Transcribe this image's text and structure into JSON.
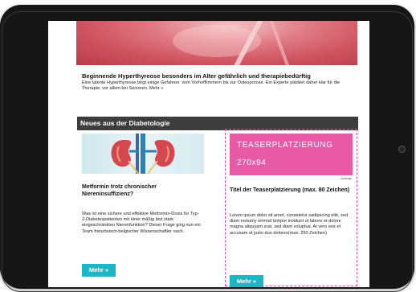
{
  "top_article": {
    "title": "Beginnende Hyperthyreose besonders im Alter gefährlich und therapiebedürftig",
    "text": "Eine latente Hyperthyreose birgt einige Gefahren: vom Vorhofflimmern bis zur Osteoporose. Ein Experte plädiert daher klar für die Therapie, vor allem bei Senioren. Mehr »"
  },
  "section": {
    "title": "Neues aus der Diabetologie"
  },
  "left_article": {
    "title": "Metformin trotz chronischer Niereninsuffizienz?",
    "text": "Was ist eine sichere und effektive Metformin-Dosis für Typ-2-Diabetespatienten mit einer mäßig bist stark eingeschränkten Nierenfunktion? Dieser Frage ging nun ein Team französisch-belgischer Wissenschaftler nach.",
    "button_label": "Mehr »"
  },
  "teaser": {
    "ad_line1": "TEASERPLATZIERUNG",
    "ad_line2": "270x94",
    "ad_label": "Anzeige",
    "title": "Titel der Teaserplatzierung (max. 80 Zeichen)",
    "text": "Lorem ipsum dolor sit amet, consetetur sadipscing elitr, sed diam nonumy eirmod tempor invidunt ut labore et dolore magna aliquyam erat, sed diam voluptua. At vero eos et accusam et justo duo dolores(max. 250 Zeichen)",
    "button_label": "Mehr »"
  },
  "colors": {
    "accent_button": "#1eb6c4",
    "teaser_pink": "#e85aa6",
    "section_bar": "#3d3d3d"
  }
}
